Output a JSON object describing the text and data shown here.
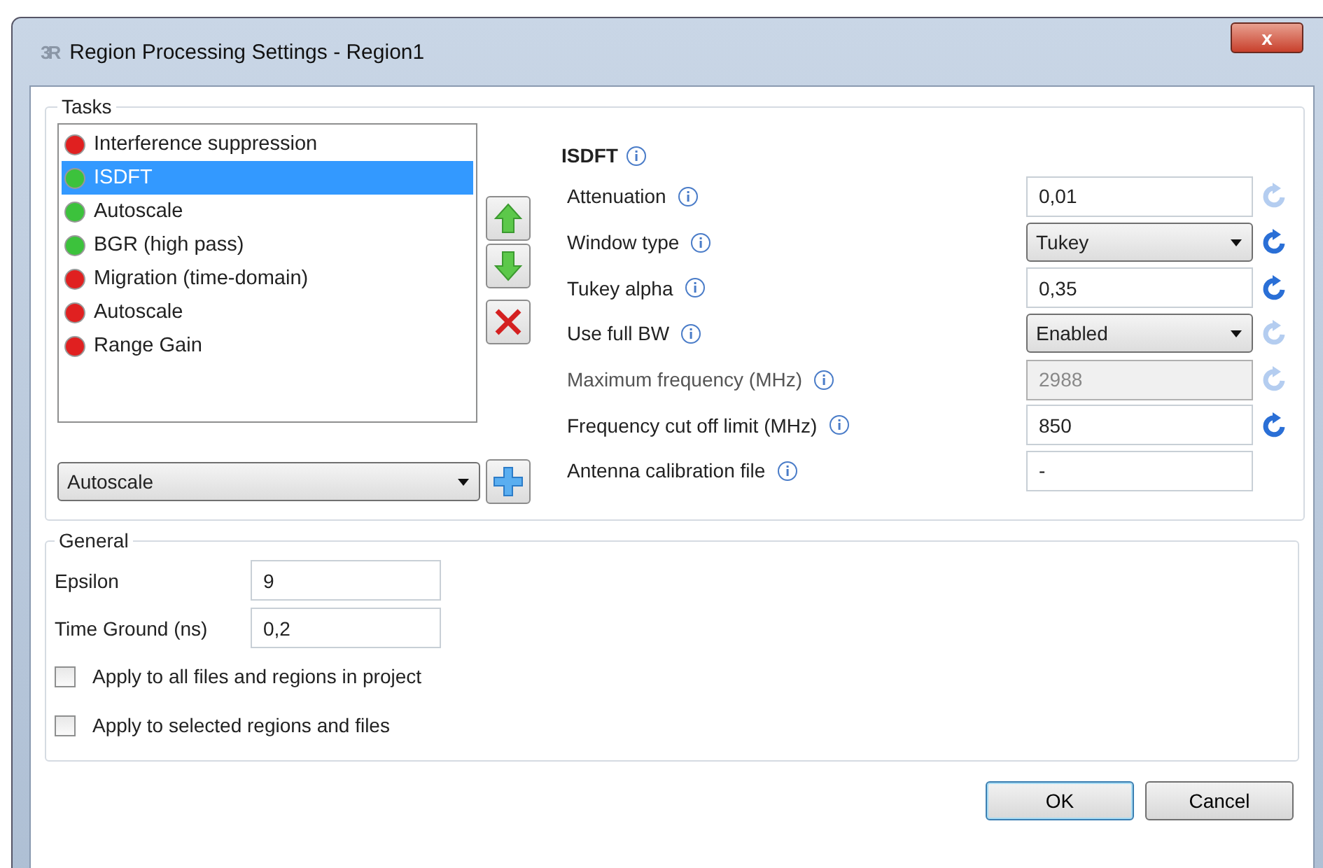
{
  "window": {
    "logo": "3R",
    "title": "Region Processing Settings - Region1",
    "close": "x"
  },
  "tasks": {
    "legend": "Tasks",
    "items": [
      {
        "label": "Interference suppression",
        "color": "#e02020",
        "selected": false
      },
      {
        "label": "ISDFT",
        "color": "#3cc23c",
        "selected": true
      },
      {
        "label": "Autoscale",
        "color": "#3cc23c",
        "selected": false
      },
      {
        "label": "BGR (high pass)",
        "color": "#3cc23c",
        "selected": false
      },
      {
        "label": "Migration (time-domain)",
        "color": "#e02020",
        "selected": false
      },
      {
        "label": "Autoscale",
        "color": "#e02020",
        "selected": false
      },
      {
        "label": "Range Gain",
        "color": "#e02020",
        "selected": false
      }
    ],
    "add_select": {
      "value": "Autoscale"
    }
  },
  "settings": {
    "title": "ISDFT",
    "rows": [
      {
        "label": "Attenuation",
        "kind": "text",
        "value": "0,01",
        "disabled": false,
        "reset_enabled": false
      },
      {
        "label": "Window type",
        "kind": "select",
        "value": "Tukey",
        "disabled": false,
        "reset_enabled": true
      },
      {
        "label": "Tukey alpha",
        "kind": "text",
        "value": "0,35",
        "disabled": false,
        "reset_enabled": true
      },
      {
        "label": "Use full BW",
        "kind": "select",
        "value": "Enabled",
        "disabled": false,
        "reset_enabled": false
      },
      {
        "label": "Maximum frequency (MHz)",
        "kind": "text",
        "value": "2988",
        "disabled": true,
        "reset_enabled": false
      },
      {
        "label": "Frequency cut off limit (MHz)",
        "kind": "text",
        "value": "850",
        "disabled": false,
        "reset_enabled": true
      },
      {
        "label": "Antenna calibration file",
        "kind": "file",
        "value": "-",
        "disabled": false
      }
    ]
  },
  "general": {
    "legend": "General",
    "fields": [
      {
        "label": "Epsilon",
        "value": "9"
      },
      {
        "label": "Time Ground (ns)",
        "value": "0,2"
      }
    ],
    "checkboxes": [
      {
        "label": "Apply to all files and regions in project",
        "checked": false
      },
      {
        "label": "Apply to selected regions and files",
        "checked": false
      }
    ]
  },
  "buttons": [
    {
      "label": "OK",
      "default": true
    },
    {
      "label": "Cancel",
      "default": false
    }
  ]
}
